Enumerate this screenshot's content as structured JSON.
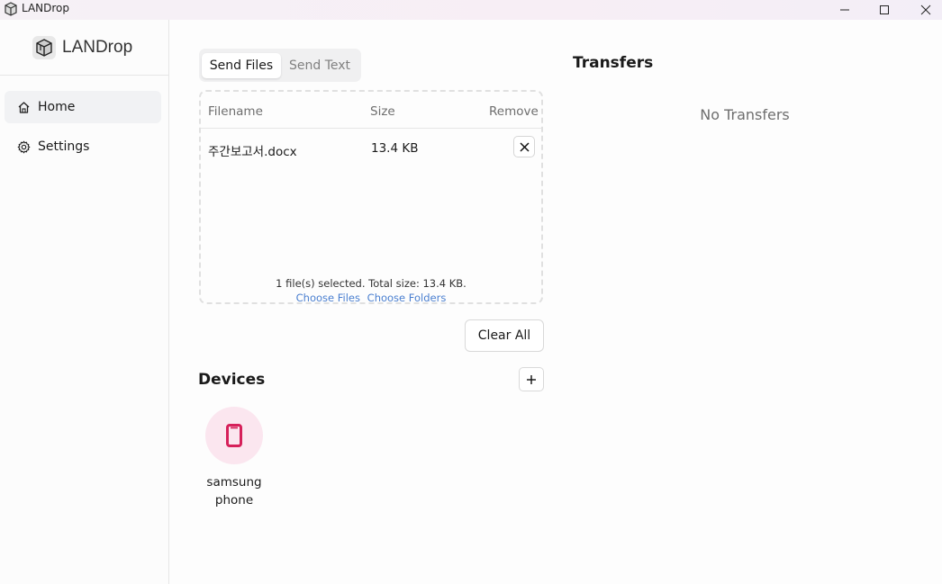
{
  "window": {
    "title": "LANDrop",
    "controls": [
      "minimize-icon",
      "maximize-icon",
      "close-icon"
    ]
  },
  "sidebar": {
    "brand": "LANDrop",
    "items": [
      {
        "label": "Home",
        "icon": "home-icon",
        "active": true
      },
      {
        "label": "Settings",
        "icon": "gear-icon",
        "active": false
      }
    ]
  },
  "send": {
    "tabs": [
      {
        "label": "Send Files",
        "selected": true
      },
      {
        "label": "Send Text",
        "selected": false
      }
    ],
    "table": {
      "columns": [
        "Filename",
        "Size",
        "Remove"
      ],
      "rows": [
        {
          "filename": "주간보고서.docx",
          "size": "13.4 KB"
        }
      ]
    },
    "summary": "1 file(s) selected. Total size: 13.4 KB.",
    "choose_files": "Choose Files",
    "choose_folders": "Choose Folders",
    "clear_all": "Clear All"
  },
  "devices": {
    "title": "Devices",
    "list": [
      {
        "name": "samsung phone",
        "icon": "phone-icon",
        "color": "#d6205a"
      }
    ]
  },
  "transfers": {
    "title": "Transfers",
    "empty": "No Transfers"
  },
  "colors": {
    "accent_link": "#4a7fd0",
    "device_bg": "#fbe6ef",
    "device_icon": "#d6205a"
  }
}
